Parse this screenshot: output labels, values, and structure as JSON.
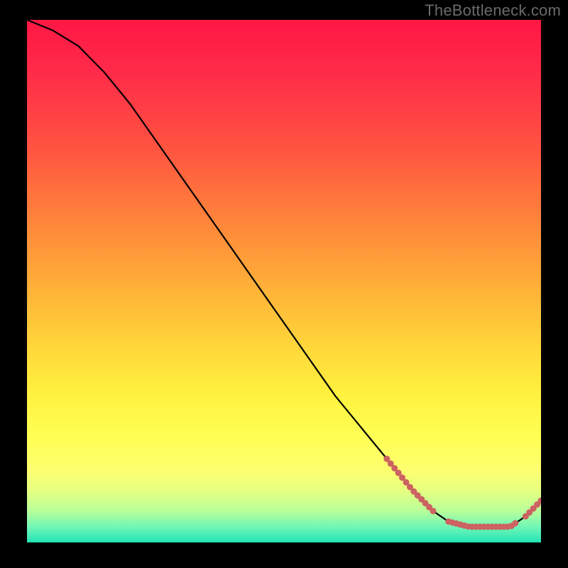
{
  "watermark": "TheBottleneck.com",
  "chart_data": {
    "type": "line",
    "title": "",
    "xlabel": "",
    "ylabel": "",
    "xlim": [
      0,
      100
    ],
    "ylim": [
      0,
      100
    ],
    "grid": false,
    "legend": false,
    "series": [
      {
        "name": "curve",
        "x": [
          0,
          5,
          10,
          15,
          20,
          25,
          30,
          35,
          40,
          45,
          50,
          55,
          60,
          65,
          70,
          75,
          79,
          82,
          86,
          90,
          94,
          97,
          100
        ],
        "y": [
          100,
          98,
          95,
          90,
          84,
          77,
          70,
          63,
          56,
          49,
          42,
          35,
          28,
          22,
          16,
          10,
          6,
          4,
          3,
          3,
          3,
          5,
          8
        ],
        "color": "#000000"
      }
    ],
    "dotted_segments": [
      {
        "x_start": 70,
        "x_end": 79
      },
      {
        "x_start": 82,
        "x_end": 95
      },
      {
        "x_start": 97,
        "x_end": 100
      }
    ],
    "dot_color": "#cc6262",
    "gradient_stops": [
      {
        "pos": 0,
        "color": "#ff1744"
      },
      {
        "pos": 40,
        "color": "#ff8a3a"
      },
      {
        "pos": 72,
        "color": "#fff23f"
      },
      {
        "pos": 100,
        "color": "#22e3b6"
      }
    ]
  }
}
